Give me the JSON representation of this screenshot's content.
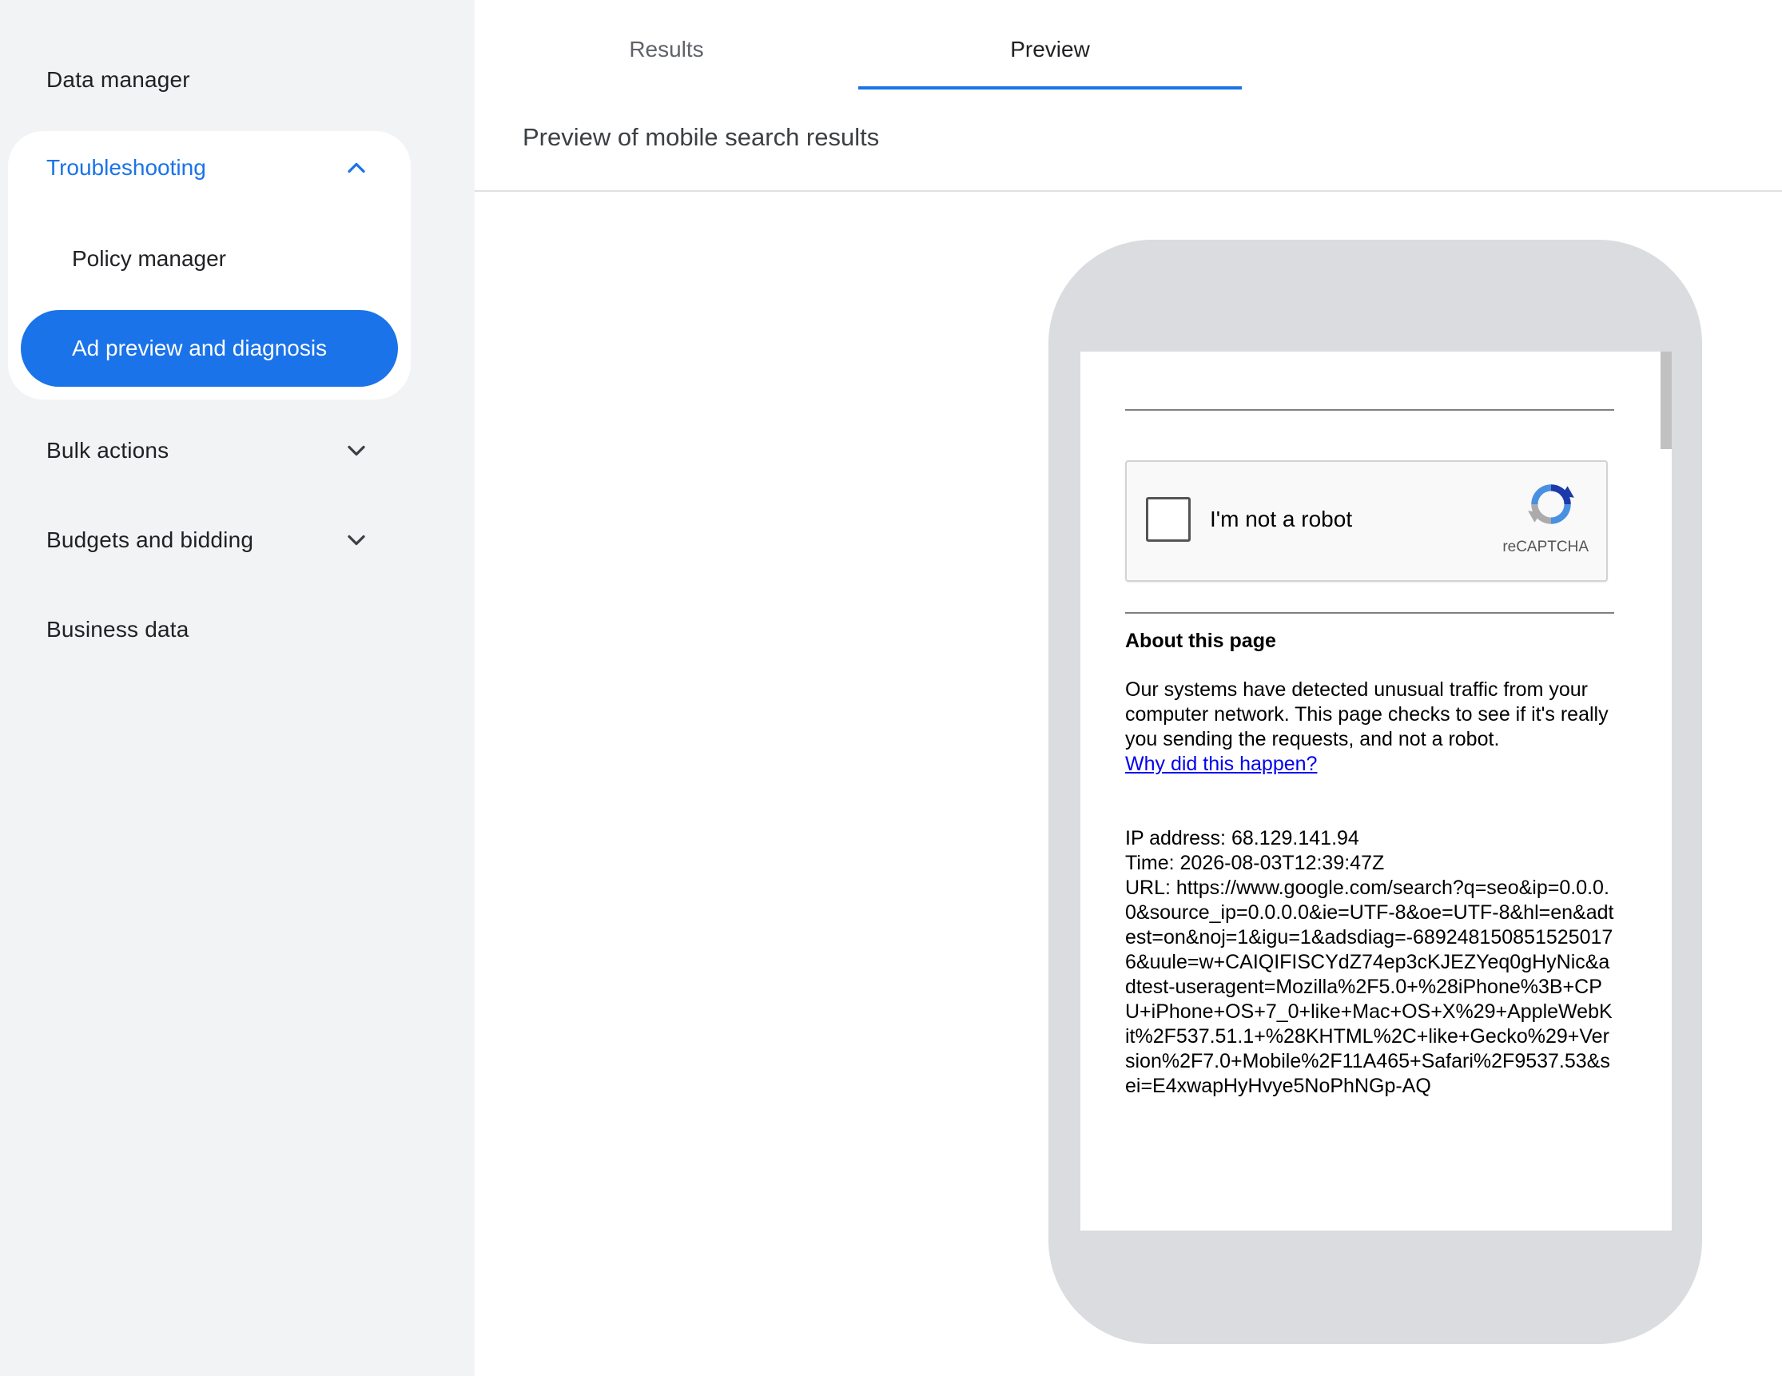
{
  "sidebar": {
    "items_top": [
      {
        "label": "Data manager"
      }
    ],
    "group": {
      "label": "Troubleshooting",
      "children": [
        {
          "label": "Policy manager",
          "active": false
        },
        {
          "label": "Ad preview and diagnosis",
          "active": true
        }
      ]
    },
    "items_bottom": [
      {
        "label": "Bulk actions"
      },
      {
        "label": "Budgets and bidding"
      },
      {
        "label": "Business data"
      }
    ]
  },
  "tabs": [
    {
      "label": "Results",
      "active": false
    },
    {
      "label": "Preview",
      "active": true
    }
  ],
  "main": {
    "section_title": "Preview of mobile search results"
  },
  "preview": {
    "captcha": {
      "label": "I'm not a robot",
      "brand": "reCAPTCHA"
    },
    "about_title": "About this page",
    "about_text": "Our systems have detected unusual traffic from your computer network. This page checks to see if it's really you sending the requests, and not a robot.",
    "about_link": "Why did this happen?",
    "ip_line": "IP address: 68.129.141.94",
    "time_line": "Time: 2026-08-03T12:39:47Z",
    "url_line": "URL: https://www.google.com/search?q=seo&ip=0.0.0.0&source_ip=0.0.0.0&ie=UTF-8&oe=UTF-8&hl=en&adtest=on&noj=1&igu=1&adsdiag=-6892481508515250176&uule=w+CAIQIFISCYdZ74ep3cKJEZYeq0gHyNic&adtest-useragent=Mozilla%2F5.0+%28iPhone%3B+CPU+iPhone+OS+7_0+like+Mac+OS+X%29+AppleWebKit%2F537.51.1+%28KHTML%2C+like+Gecko%29+Version%2F7.0+Mobile%2F11A465+Safari%2F9537.53&sei=E4xwapHyHvye5NoPhNGp-AQ"
  },
  "colors": {
    "accent": "#1a73e8",
    "sidebar_bg": "#f1f3f4",
    "phone_frame": "#dadce0",
    "link": "#0000ee"
  },
  "icons": {
    "expand_less": "chevron-up-icon",
    "expand_more": "chevron-down-icon",
    "recaptcha": "recaptcha-logo-icon"
  }
}
